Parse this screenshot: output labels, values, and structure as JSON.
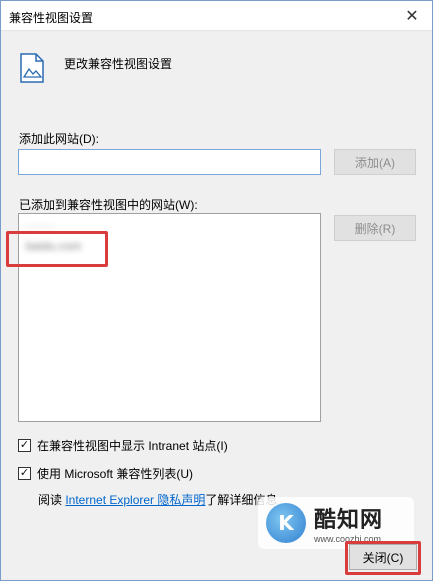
{
  "window": {
    "title": "兼容性视图设置",
    "close_glyph": "✕"
  },
  "header": {
    "icon": "document-image-icon",
    "title": "更改兼容性视图设置"
  },
  "add_site": {
    "label": "添加此网站(D):",
    "input_value": "",
    "button_label": "添加(A)"
  },
  "site_list": {
    "label": "已添加到兼容性视图中的网站(W):",
    "items": [
      "·······",
      "baidu.com"
    ],
    "remove_label": "删除(R)"
  },
  "options": {
    "intranet_label": "在兼容性视图中显示 Intranet 站点(I)",
    "intranet_checked": true,
    "microsoft_list_label": "使用 Microsoft 兼容性列表(U)",
    "microsoft_list_checked": true
  },
  "privacy": {
    "prefix": "阅读 ",
    "link_text": "Internet Explorer 隐私声明",
    "suffix": "了解详细信息"
  },
  "footer": {
    "close_label": "关闭(C)"
  },
  "watermark": {
    "name": "酷知网",
    "url": "www.coozhi.com"
  },
  "colors": {
    "highlight": "#d93c3c",
    "link": "#0066cc",
    "dialog_bg": "#f0f0f0"
  }
}
